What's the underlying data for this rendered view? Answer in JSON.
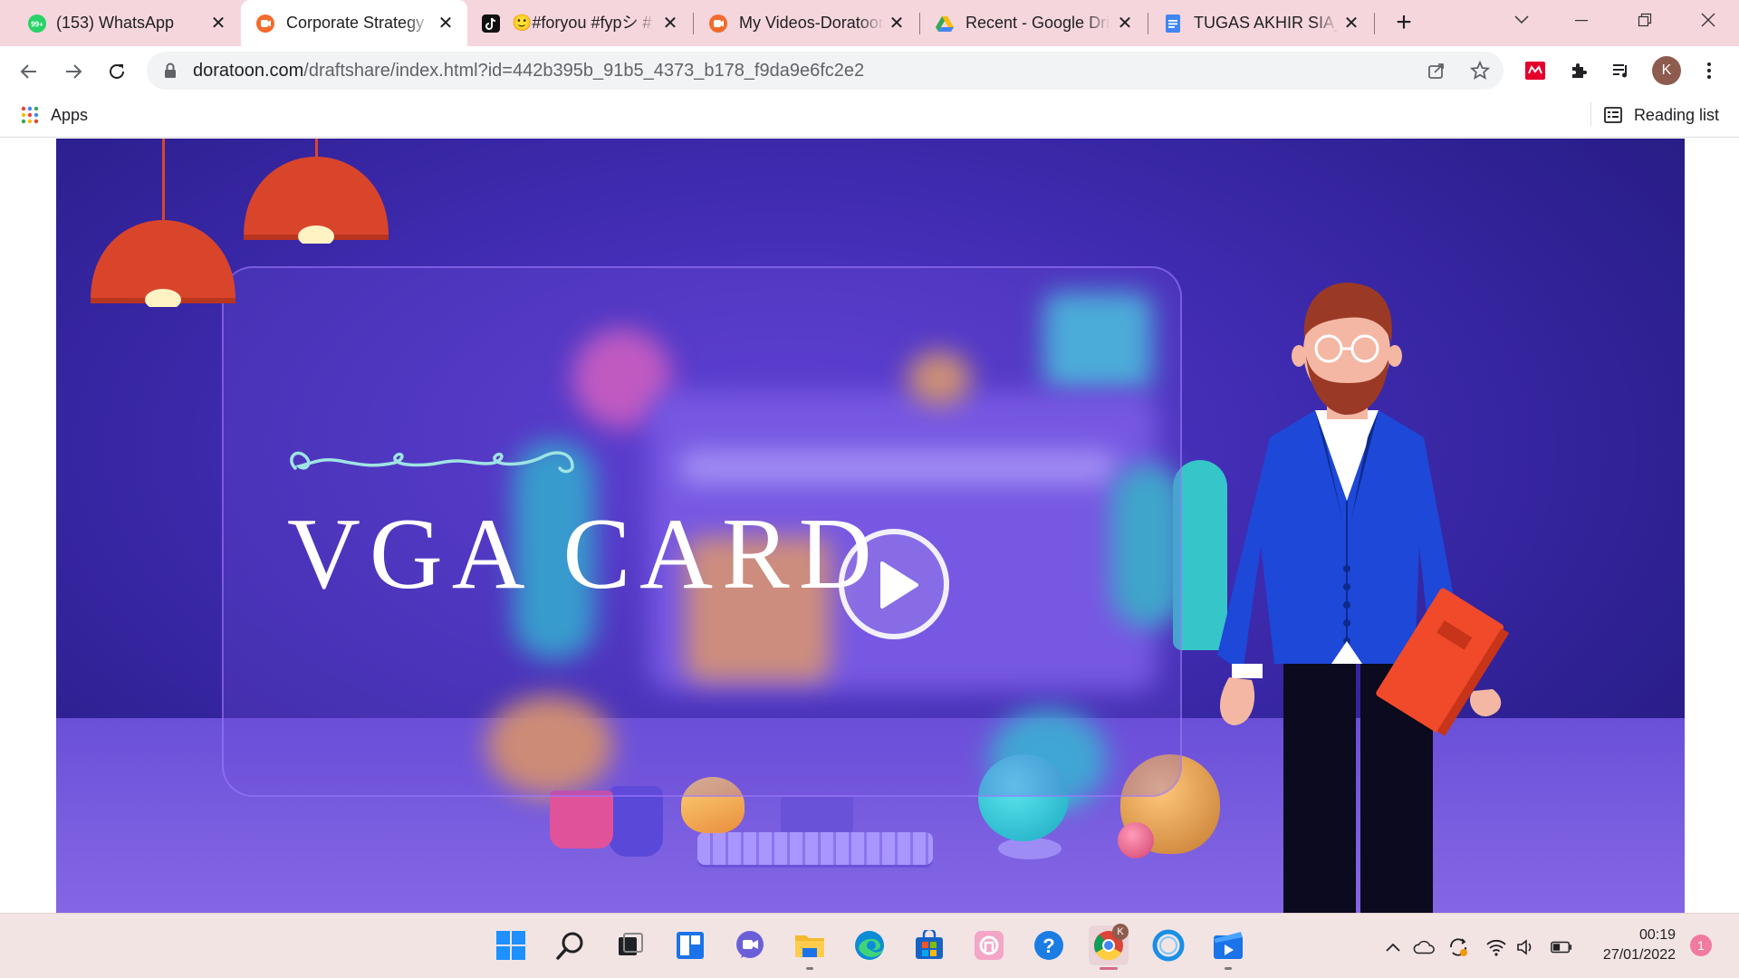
{
  "browser": {
    "tabs": [
      {
        "title": "(153) WhatsApp",
        "icon": "whatsapp-icon",
        "badge": "99+"
      },
      {
        "title": "Corporate Strategy",
        "icon": "doratoon-icon",
        "active": true
      },
      {
        "title": "🙂#foryou #fypシ #",
        "icon": "tiktok-icon"
      },
      {
        "title": "My Videos-Doratoon",
        "icon": "doratoon-icon"
      },
      {
        "title": "Recent - Google Drive",
        "icon": "google-drive-icon"
      },
      {
        "title": "TUGAS AKHIR SIA_K",
        "icon": "google-docs-icon"
      }
    ],
    "close_glyph": "✕",
    "new_tab_glyph": "+",
    "address": {
      "host": "doratoon.com",
      "path": "/draftshare/index.html?id=442b395b_91b5_4373_b178_f9da9e6fc2e2"
    },
    "profile_initial": "K",
    "bookmarks": {
      "apps_label": "Apps",
      "reading_list_label": "Reading list"
    }
  },
  "video": {
    "title": "VGA CARD",
    "colors": {
      "background": "#3f2bb0",
      "lamp": "#d9452b",
      "jacket": "#1d48d8",
      "book": "#f04a2a"
    }
  },
  "taskbar": {
    "apps": [
      "windows-start-icon",
      "search-icon",
      "task-view-icon",
      "widgets-icon",
      "teams-chat-icon",
      "file-explorer-icon",
      "edge-icon",
      "microsoft-store-icon",
      "app-pink-icon",
      "help-icon",
      "chrome-icon",
      "cortana-icon",
      "media-player-icon"
    ],
    "chrome_profile_badge": "K",
    "time": "00:19",
    "date": "27/01/2022",
    "notification_count": "1"
  }
}
